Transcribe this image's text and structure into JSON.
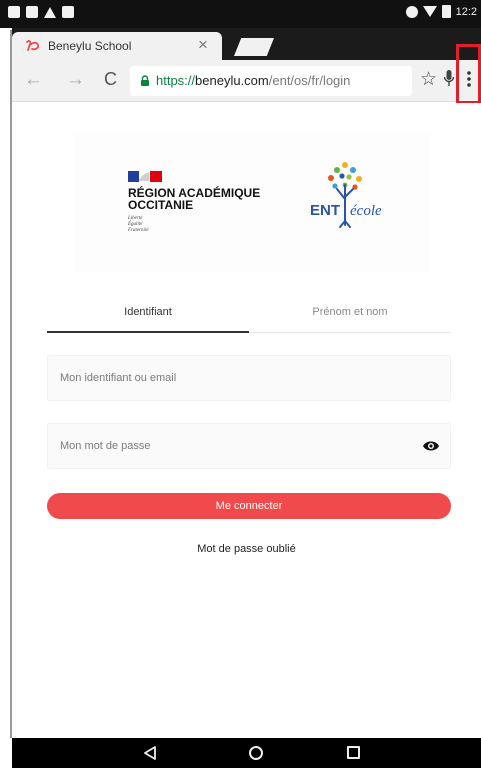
{
  "status_bar": {
    "time": "12:2"
  },
  "browser": {
    "tab_title": "Beneylu School",
    "tab_close": "×",
    "url": {
      "scheme": "https://",
      "host": "beneylu.com",
      "path": "/ent/os/fr/login"
    }
  },
  "icons": {
    "back": "←",
    "forward": "→",
    "reload": "C",
    "star": "☆"
  },
  "logos": {
    "region_title": "RÉGION ACADÉMIQUE OCCITANIE",
    "devise_1": "Liberté",
    "devise_2": "Égalité",
    "devise_3": "Fraternité",
    "ent": "ENT",
    "ecole": "école"
  },
  "login": {
    "tab_identifiant": "Identifiant",
    "tab_prenom_nom": "Prénom et nom",
    "identifiant_placeholder": "Mon identifiant ou email",
    "password_placeholder": "Mon mot de passe",
    "submit_label": "Me connecter",
    "forgot_label": "Mot de passe oublié"
  },
  "colors": {
    "brand_red": "#f04a4c",
    "highlight": "#e01f2b",
    "secure_green": "#0b8043",
    "ent_blue": "#2a55a6"
  }
}
